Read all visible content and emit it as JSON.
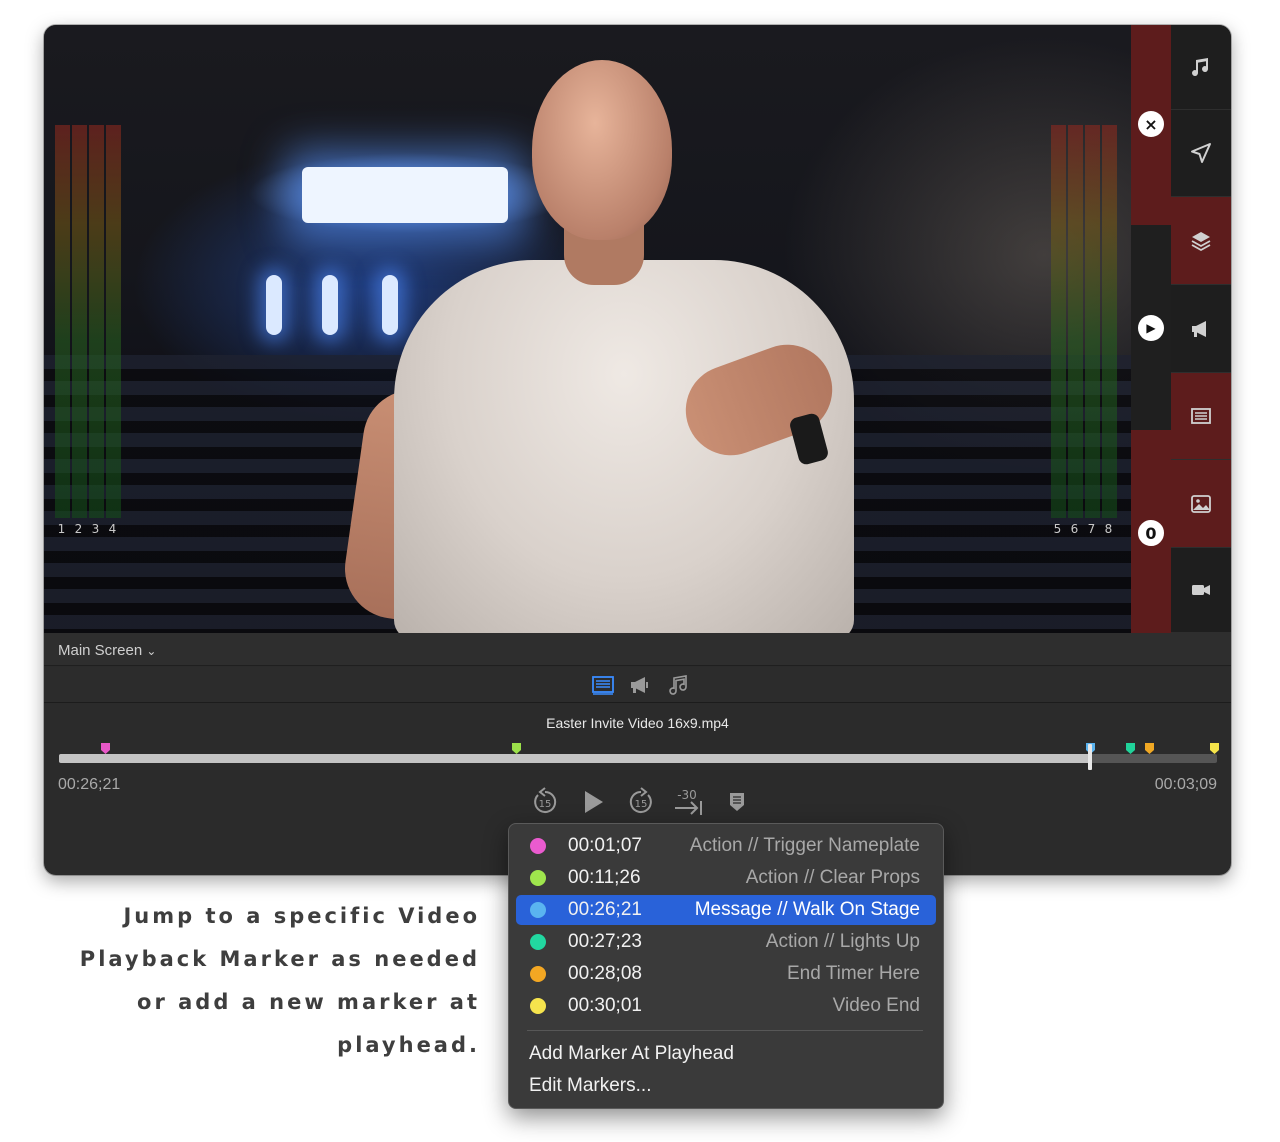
{
  "screen": {
    "label": "Main Screen",
    "chevron": "chevron-down-icon"
  },
  "meters": {
    "left_labels": [
      "1",
      "2",
      "3",
      "4"
    ],
    "right_labels": [
      "5",
      "6",
      "7",
      "8"
    ]
  },
  "overlay_buttons": {
    "close": "×",
    "play": "▶",
    "counter": "0"
  },
  "sidebar": {
    "items": [
      {
        "icon": "music-note-icon"
      },
      {
        "icon": "send-arrow-icon"
      },
      {
        "icon": "layers-icon"
      },
      {
        "icon": "megaphone-icon"
      },
      {
        "icon": "slides-icon"
      },
      {
        "icon": "image-icon"
      },
      {
        "icon": "video-camera-icon"
      }
    ]
  },
  "tabs": [
    {
      "icon": "slides-icon",
      "active": true
    },
    {
      "icon": "megaphone-icon",
      "active": false
    },
    {
      "icon": "music-note-icon",
      "active": false
    }
  ],
  "player": {
    "filename": "Easter Invite Video 16x9.mp4",
    "elapsed": "00:26;21",
    "remaining": "00:03;09",
    "progress": 0.89,
    "markers": [
      {
        "position": 0.04,
        "color": "#e858c8"
      },
      {
        "position": 0.395,
        "color": "#9be04a"
      },
      {
        "position": 0.89,
        "color": "#5ab4f0"
      },
      {
        "position": 0.925,
        "color": "#20d39a"
      },
      {
        "position": 0.941,
        "color": "#f0a824"
      },
      {
        "position": 0.997,
        "color": "#f5e44a"
      }
    ],
    "transport": {
      "back": "15",
      "forward": "15",
      "jump": "-30"
    }
  },
  "menu": {
    "items": [
      {
        "time": "00:01;07",
        "label": "Action // Trigger Nameplate",
        "color": "#ea5bcf",
        "selected": false
      },
      {
        "time": "00:11;26",
        "label": "Action // Clear Props",
        "color": "#9fe54d",
        "selected": false
      },
      {
        "time": "00:26;21",
        "label": "Message // Walk On Stage",
        "color": "#5ab4f0",
        "selected": true
      },
      {
        "time": "00:27;23",
        "label": "Action // Lights Up",
        "color": "#22d7a0",
        "selected": false
      },
      {
        "time": "00:28;08",
        "label": "End Timer Here",
        "color": "#f3a723",
        "selected": false
      },
      {
        "time": "00:30;01",
        "label": "Video End",
        "color": "#f6e44d",
        "selected": false
      }
    ],
    "add_marker": "Add Marker At Playhead",
    "edit_markers": "Edit Markers..."
  },
  "caption": {
    "lines": [
      "Jump to a specific Video",
      "Playback Marker as needed",
      "or add a new marker at",
      "playhead."
    ]
  }
}
